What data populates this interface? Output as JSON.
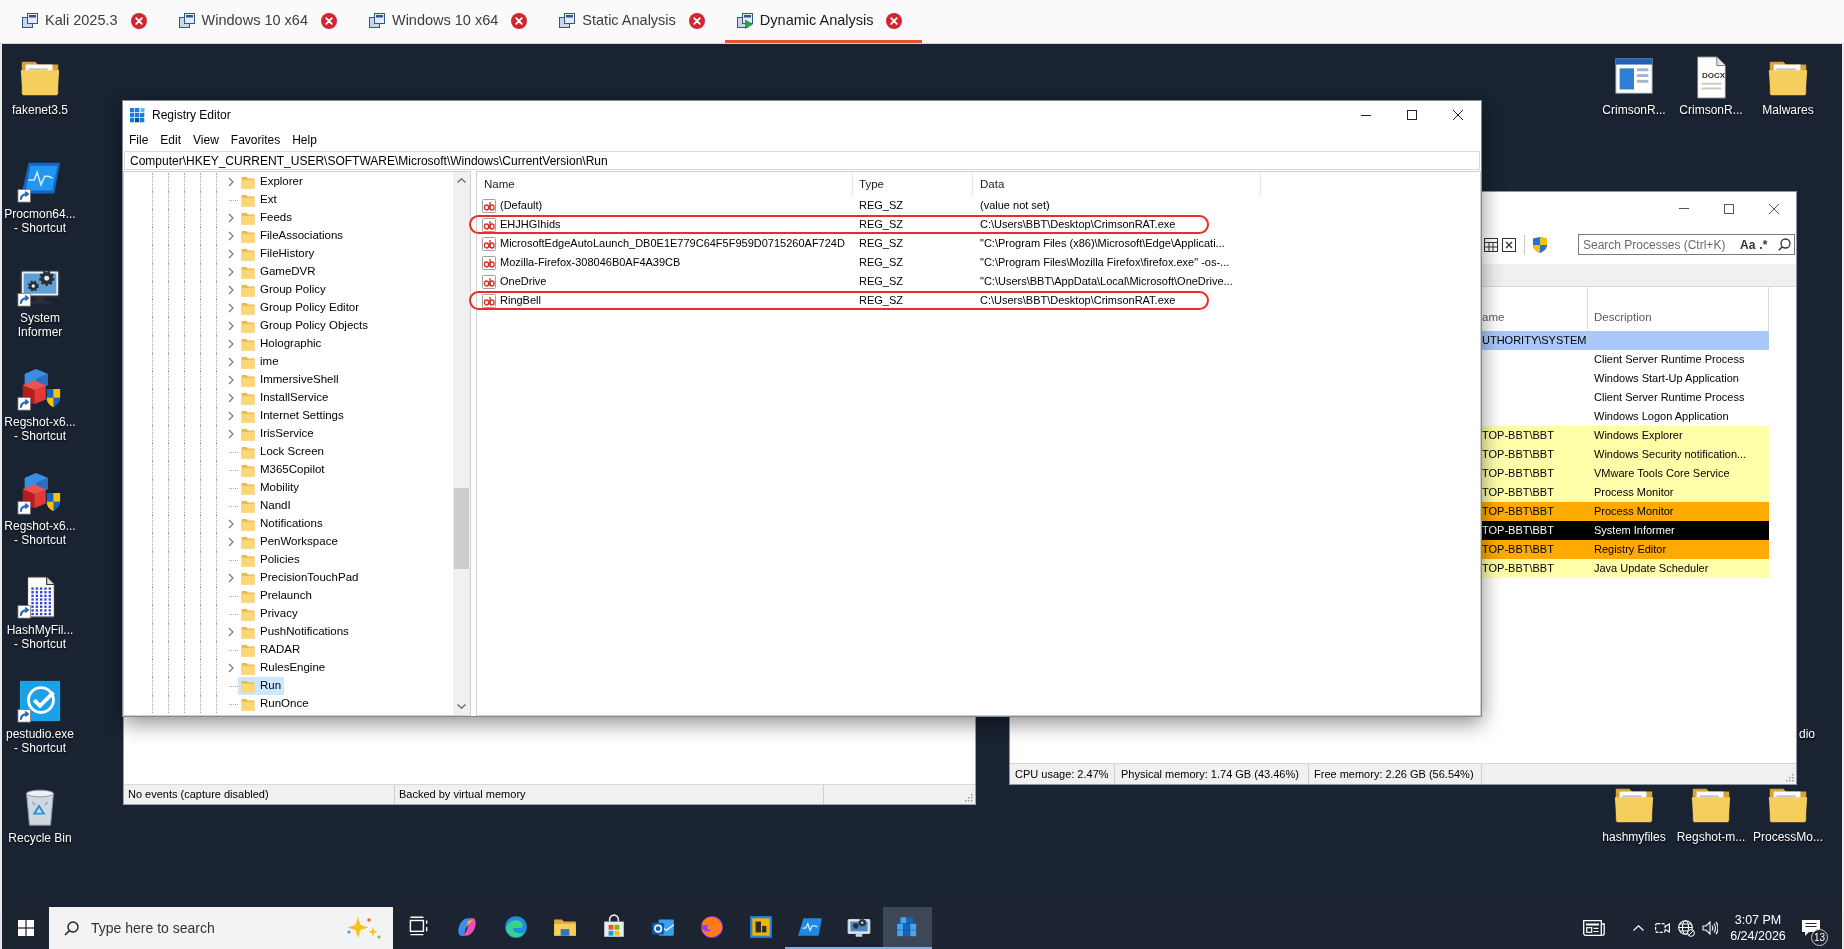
{
  "tabs": [
    {
      "label": "Kali 2025.3",
      "selected": false,
      "running": false
    },
    {
      "label": "Windows 10 x64",
      "selected": false,
      "running": false
    },
    {
      "label": "Windows 10 x64",
      "selected": false,
      "running": false
    },
    {
      "label": "Static Analysis",
      "selected": false,
      "running": false
    },
    {
      "label": "Dynamic Analysis",
      "selected": true,
      "running": true
    }
  ],
  "desktop": {
    "left_icons": [
      {
        "label": "fakenet3.5",
        "kind": "folder",
        "shortcut": false
      },
      {
        "label": "Procmon64... - Shortcut",
        "kind": "wave",
        "shortcut": true
      },
      {
        "label": "System Informer",
        "kind": "gears",
        "shortcut": true
      },
      {
        "label": "Regshot-x6... - Shortcut",
        "kind": "cubes",
        "shortcut": true
      },
      {
        "label": "Regshot-x6... - Shortcut",
        "kind": "cubes",
        "shortcut": true
      },
      {
        "label": "HashMyFil... - Shortcut",
        "kind": "dotsheet",
        "shortcut": true
      },
      {
        "label": "pestudio.exe - Shortcut",
        "kind": "check",
        "shortcut": true
      },
      {
        "label": "Recycle Bin",
        "kind": "bin",
        "shortcut": false
      }
    ],
    "right_top_icons": [
      {
        "label": "CrimsonR...",
        "kind": "app",
        "shortcut": false
      },
      {
        "label": "CrimsonR...",
        "kind": "document",
        "shortcut": false,
        "badge": "DOCX"
      },
      {
        "label": "Malwares",
        "kind": "folder",
        "shortcut": false
      }
    ],
    "right_bottom_icons": [
      {
        "label": "hashmyfiles",
        "kind": "folder",
        "shortcut": false
      },
      {
        "label": "Regshot-m...",
        "kind": "folder",
        "shortcut": false
      },
      {
        "label": "ProcessMo...",
        "kind": "folder",
        "shortcut": false
      }
    ],
    "partial_icon_label": "dio"
  },
  "process_monitor": {
    "status_bar": [
      "No events (capture disabled)",
      "Backed by virtual memory"
    ]
  },
  "system_informer": {
    "search": {
      "placeholder": "Search Processes (Ctrl+K)"
    },
    "search_toggles": [
      "Aa",
      ".*"
    ],
    "columns": [
      "ame",
      "Description"
    ],
    "rows": [
      {
        "user": "UTHORITY\\SYSTEM",
        "color": "#aac8fa"
      },
      {
        "description": "Client Server Runtime Process"
      },
      {
        "description": "Windows Start-Up Application"
      },
      {
        "description": "Client Server Runtime Process"
      },
      {
        "description": "Windows Logon Application"
      },
      {
        "user": "TOP-BBT\\BBT",
        "description": "Windows Explorer",
        "color": "#ffffaa"
      },
      {
        "user": "TOP-BBT\\BBT",
        "description": "Windows Security notification...",
        "color": "#ffffaa"
      },
      {
        "user": "TOP-BBT\\BBT",
        "description": "VMware Tools Core Service",
        "color": "#ffffaa"
      },
      {
        "user": "TOP-BBT\\BBT",
        "description": "Process Monitor",
        "color": "#ffffaa"
      },
      {
        "user": "TOP-BBT\\BBT",
        "description": "Process Monitor",
        "color": "#ffaa00"
      },
      {
        "user": "TOP-BBT\\BBT",
        "description": "System Informer",
        "color": "#000000"
      },
      {
        "user": "TOP-BBT\\BBT",
        "description": "Registry Editor",
        "color": "#ffaa00"
      },
      {
        "user": "TOP-BBT\\BBT",
        "description": "Java Update Scheduler",
        "color": "#ffffaa"
      }
    ],
    "status_bar": [
      "CPU usage: 2.47%",
      "Physical memory: 1.74 GB (43.46%)",
      "Free memory: 2.26 GB (56.54%)"
    ]
  },
  "registry_editor": {
    "title": "Registry Editor",
    "menu": [
      "File",
      "Edit",
      "View",
      "Favorites",
      "Help"
    ],
    "address": "Computer\\HKEY_CURRENT_USER\\SOFTWARE\\Microsoft\\Windows\\CurrentVersion\\Run",
    "tree": [
      {
        "label": "Explorer",
        "expandable": true,
        "selected": false
      },
      {
        "label": "Ext",
        "expandable": false,
        "selected": false
      },
      {
        "label": "Feeds",
        "expandable": true,
        "selected": false
      },
      {
        "label": "FileAssociations",
        "expandable": true,
        "selected": false
      },
      {
        "label": "FileHistory",
        "expandable": true,
        "selected": false
      },
      {
        "label": "GameDVR",
        "expandable": true,
        "selected": false
      },
      {
        "label": "Group Policy",
        "expandable": true,
        "selected": false
      },
      {
        "label": "Group Policy Editor",
        "expandable": true,
        "selected": false
      },
      {
        "label": "Group Policy Objects",
        "expandable": true,
        "selected": false
      },
      {
        "label": "Holographic",
        "expandable": true,
        "selected": false
      },
      {
        "label": "ime",
        "expandable": true,
        "selected": false
      },
      {
        "label": "ImmersiveShell",
        "expandable": true,
        "selected": false
      },
      {
        "label": "InstallService",
        "expandable": true,
        "selected": false
      },
      {
        "label": "Internet Settings",
        "expandable": true,
        "selected": false
      },
      {
        "label": "IrisService",
        "expandable": true,
        "selected": false
      },
      {
        "label": "Lock Screen",
        "expandable": false,
        "selected": false
      },
      {
        "label": "M365Copilot",
        "expandable": false,
        "selected": false
      },
      {
        "label": "Mobility",
        "expandable": false,
        "selected": false
      },
      {
        "label": "NandI",
        "expandable": false,
        "selected": false
      },
      {
        "label": "Notifications",
        "expandable": true,
        "selected": false
      },
      {
        "label": "PenWorkspace",
        "expandable": true,
        "selected": false
      },
      {
        "label": "Policies",
        "expandable": false,
        "selected": false
      },
      {
        "label": "PrecisionTouchPad",
        "expandable": true,
        "selected": false
      },
      {
        "label": "Prelaunch",
        "expandable": false,
        "selected": false
      },
      {
        "label": "Privacy",
        "expandable": false,
        "selected": false
      },
      {
        "label": "PushNotifications",
        "expandable": true,
        "selected": false
      },
      {
        "label": "RADAR",
        "expandable": false,
        "selected": false
      },
      {
        "label": "RulesEngine",
        "expandable": true,
        "selected": false
      },
      {
        "label": "Run",
        "expandable": false,
        "selected": true
      },
      {
        "label": "RunOnce",
        "expandable": false,
        "selected": false
      }
    ],
    "columns": [
      "Name",
      "Type",
      "Data"
    ],
    "values": [
      {
        "name": "(Default)",
        "type": "REG_SZ",
        "data": "(value not set)",
        "highlighted": false
      },
      {
        "name": "EHJHGIhids",
        "type": "REG_SZ",
        "data": "C:\\Users\\BBT\\Desktop\\CrimsonRAT.exe",
        "highlighted": true
      },
      {
        "name": "MicrosoftEdgeAutoLaunch_DB0E1E779C64F5F959D0715260AF724D",
        "type": "REG_SZ",
        "data": "\"C:\\Program Files (x86)\\Microsoft\\Edge\\Applicati...",
        "highlighted": false
      },
      {
        "name": "Mozilla-Firefox-308046B0AF4A39CB",
        "type": "REG_SZ",
        "data": "\"C:\\Program Files\\Mozilla Firefox\\firefox.exe\" -os-...",
        "highlighted": false
      },
      {
        "name": "OneDrive",
        "type": "REG_SZ",
        "data": "\"C:\\Users\\BBT\\AppData\\Local\\Microsoft\\OneDrive...",
        "highlighted": false
      },
      {
        "name": "RingBell",
        "type": "REG_SZ",
        "data": "C:\\Users\\BBT\\Desktop\\CrimsonRAT.exe",
        "highlighted": true
      }
    ]
  },
  "taskbar": {
    "search": {
      "placeholder": "Type here to search"
    },
    "apps": [
      {
        "kind": "taskview",
        "running": false,
        "active": false
      },
      {
        "kind": "ribbon",
        "running": false,
        "active": false
      },
      {
        "kind": "swirl",
        "running": false,
        "active": false
      },
      {
        "kind": "folder",
        "running": false,
        "active": false
      },
      {
        "kind": "bag",
        "running": false,
        "active": false
      },
      {
        "kind": "mail",
        "running": false,
        "active": false
      },
      {
        "kind": "fox",
        "running": false,
        "active": false
      },
      {
        "kind": "tile",
        "running": false,
        "active": false
      },
      {
        "kind": "wave",
        "running": true,
        "active": false
      },
      {
        "kind": "gears",
        "running": true,
        "active": false
      },
      {
        "kind": "cubes",
        "running": true,
        "active": true
      }
    ],
    "clock": {
      "time": "3:07 PM",
      "date": "6/24/2026"
    },
    "notification_count": "13"
  }
}
